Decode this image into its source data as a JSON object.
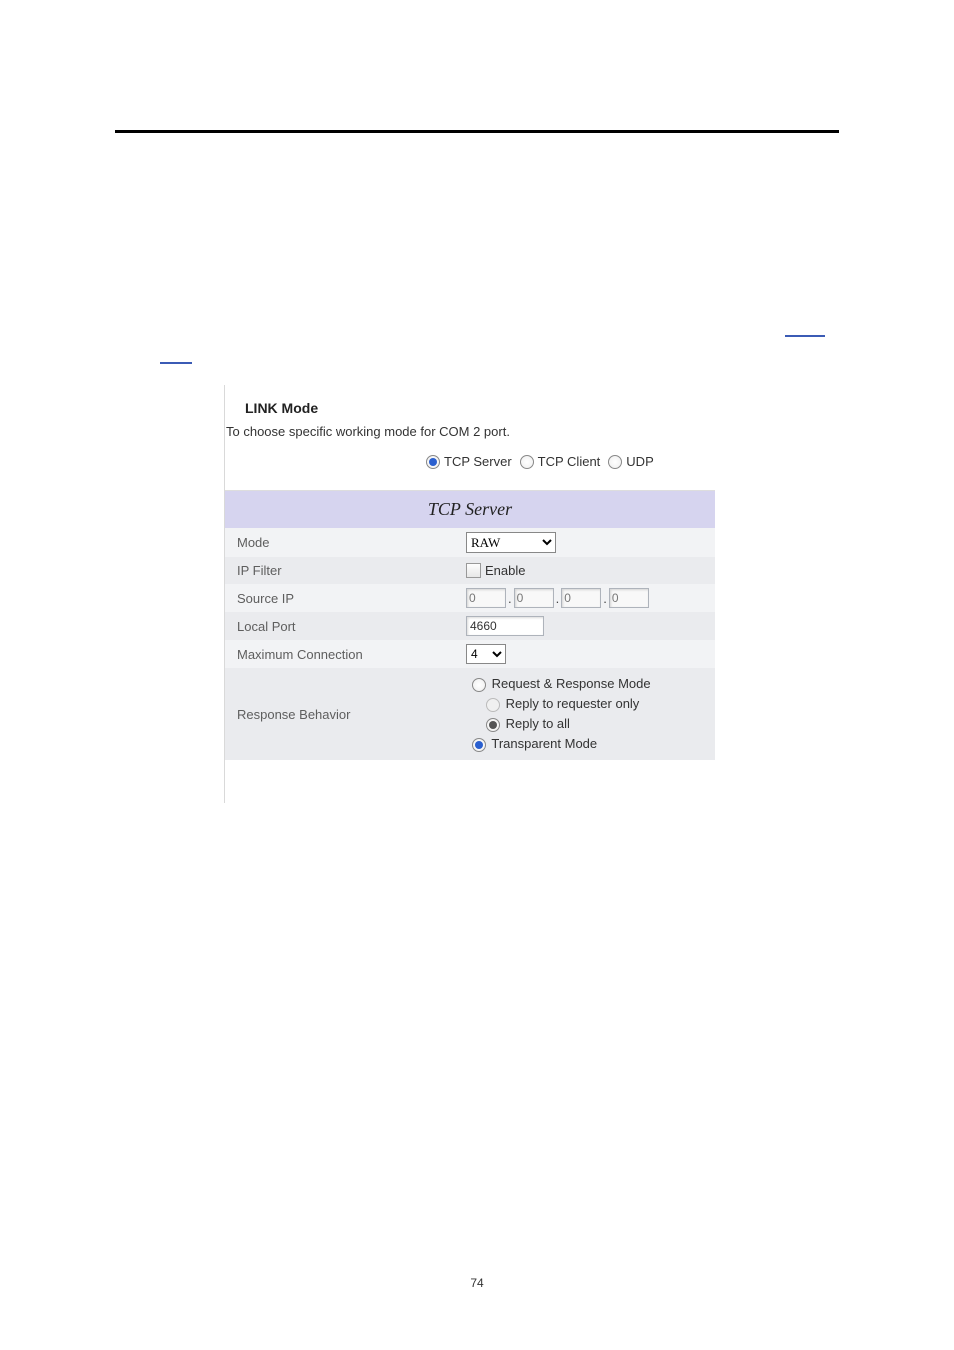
{
  "page_number": "74",
  "section": {
    "title": "LINK Mode",
    "description": "To choose specific working mode for COM 2 port."
  },
  "link_mode": {
    "options": {
      "tcp_server": "TCP Server",
      "tcp_client": "TCP Client",
      "udp": "UDP"
    },
    "selected": "tcp_server"
  },
  "panel": {
    "header": "TCP Server",
    "rows": {
      "mode": {
        "label": "Mode",
        "value": "RAW"
      },
      "ip_filter": {
        "label": "IP Filter",
        "checkbox_label": "Enable",
        "checked": false
      },
      "source_ip": {
        "label": "Source IP",
        "octets": [
          "0",
          "0",
          "0",
          "0"
        ]
      },
      "local_port": {
        "label": "Local Port",
        "value": "4660"
      },
      "max_conn": {
        "label": "Maximum Connection",
        "value": "4"
      },
      "response_behavior": {
        "label": "Response Behavior",
        "request_response": "Request & Response Mode",
        "reply_requester": "Reply to requester only",
        "reply_all": "Reply to all",
        "transparent": "Transparent Mode"
      }
    }
  }
}
